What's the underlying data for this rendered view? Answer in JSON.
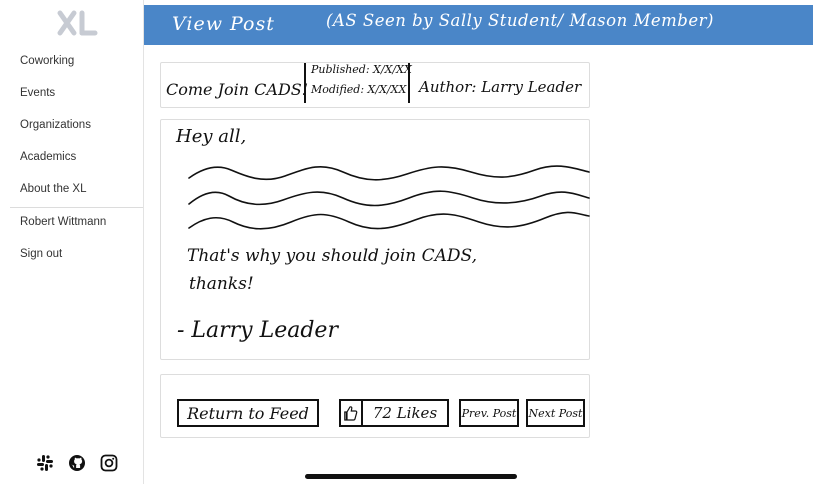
{
  "sidebar": {
    "logo_icon": "xl-logo-icon",
    "items": [
      {
        "label": "Coworking"
      },
      {
        "label": "Events"
      },
      {
        "label": "Organizations"
      },
      {
        "label": "Academics"
      },
      {
        "label": "About the XL"
      }
    ],
    "user_name": "Robert Wittmann",
    "sign_out_label": "Sign out",
    "social_icons": [
      "slack-icon",
      "github-icon",
      "instagram-icon"
    ]
  },
  "header": {
    "title": "View Post",
    "subtitle": "(AS Seen by Sally Student/ Mason Member)"
  },
  "post": {
    "title": "Come Join CADS!",
    "published": "Published: X/X/XX",
    "modified": "Modified: X/X/XX",
    "author": "Author: Larry Leader",
    "greeting": "Hey all,",
    "message_line1": "That's why you should join CADS,",
    "message_line2": "thanks!",
    "signature": "- Larry Leader"
  },
  "actions": {
    "return_label": "Return to Feed",
    "like_icon": "thumbs-up-icon",
    "likes_label": "72 Likes",
    "prev_label": "Prev. Post",
    "next_label": "Next Post"
  },
  "colors": {
    "header_bg": "#4a86c8",
    "header_text": "#ffffff"
  }
}
